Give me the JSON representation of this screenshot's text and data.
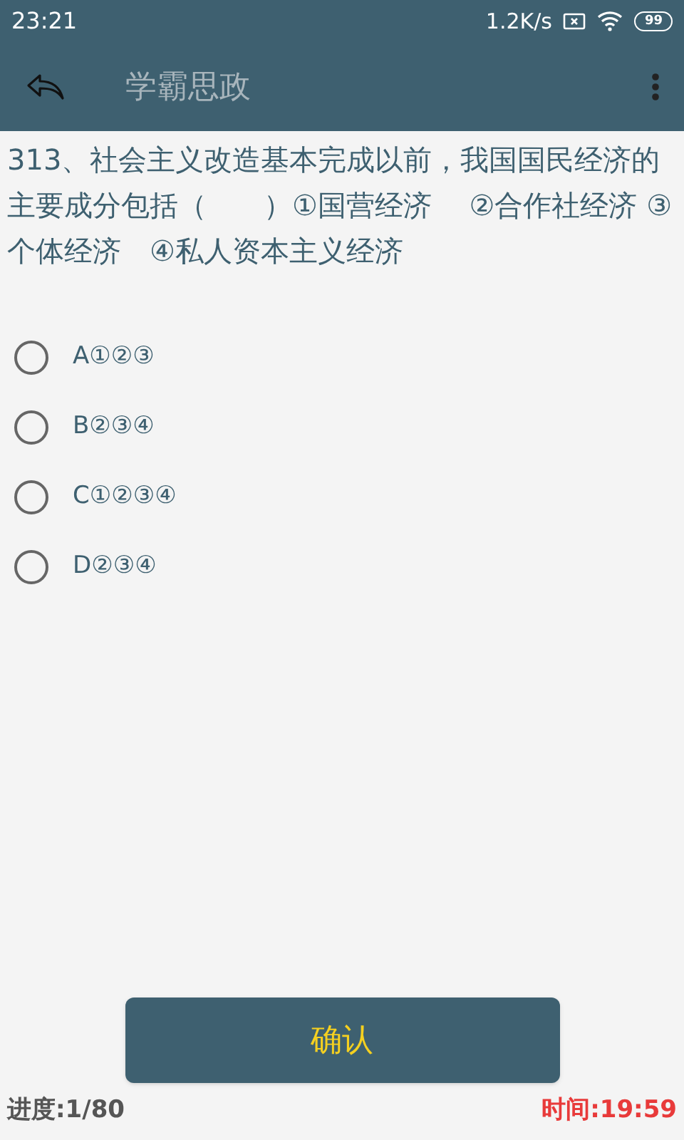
{
  "status_bar": {
    "time": "23:21",
    "speed": "1.2K/s",
    "battery": "99"
  },
  "toolbar": {
    "title": "学霸思政"
  },
  "question": {
    "text": "313、社会主义改造基本完成以前，我国国民经济的主要成分包括（　　）①国营经济　 ②合作社经济 ③个体经济　④私人资本主义经济"
  },
  "options": [
    {
      "label": "A①②③",
      "selected": false
    },
    {
      "label": "B②③④",
      "selected": false
    },
    {
      "label": "C①②③④",
      "selected": false
    },
    {
      "label": "D②③④",
      "selected": false
    }
  ],
  "confirm_button": "确认",
  "footer": {
    "progress": "进度:1/80",
    "timer": "时间:19:59"
  }
}
